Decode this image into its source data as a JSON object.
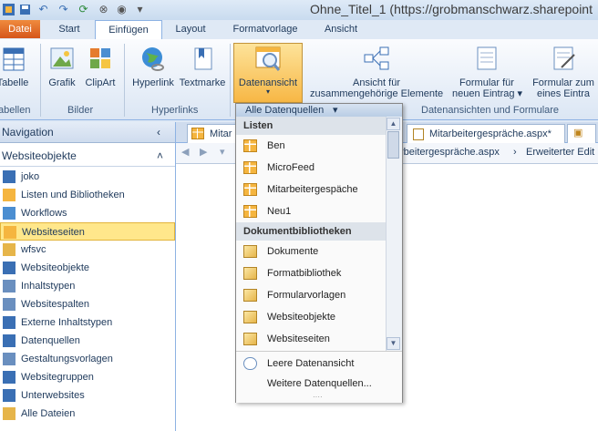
{
  "window": {
    "title": "Ohne_Titel_1 (https://grobmanschwarz.sharepoint"
  },
  "tabs": [
    "Datei",
    "Start",
    "Einfügen",
    "Layout",
    "Formatvorlage",
    "Ansicht"
  ],
  "ribbon": {
    "buttons": {
      "tabelle": "Tabelle",
      "grafik": "Grafik",
      "clipart": "ClipArt",
      "hyperlink": "Hyperlink",
      "textmarke": "Textmarke",
      "datenansicht": "Datenansicht",
      "ansicht_line1": "Ansicht für",
      "ansicht_line2": "zusammengehörige Elemente",
      "formular_neu_line1": "Formular für",
      "formular_neu_line2": "neuen Eintrag",
      "formular_zum_line1": "Formular zum",
      "formular_zum_line2": "eines Eintra"
    },
    "groups": {
      "tabellen": "abellen",
      "bilder": "Bilder",
      "hyperlinks": "Hyperlinks",
      "datenansichten": "Datenansichten und Formulare"
    }
  },
  "nav": {
    "header": "Navigation",
    "section": "Websiteobjekte",
    "items": [
      {
        "label": "joko",
        "icon": "site-icon"
      },
      {
        "label": "Listen und Bibliotheken",
        "icon": "list-icon"
      },
      {
        "label": "Workflows",
        "icon": "workflow-icon"
      },
      {
        "label": "Websiteseiten",
        "icon": "page-icon"
      },
      {
        "label": "wfsvc",
        "icon": "folder-icon"
      },
      {
        "label": "Websiteobjekte",
        "icon": "site-objects-icon"
      },
      {
        "label": "Inhaltstypen",
        "icon": "content-types-icon"
      },
      {
        "label": "Websitespalten",
        "icon": "columns-icon"
      },
      {
        "label": "Externe Inhaltstypen",
        "icon": "external-content-icon"
      },
      {
        "label": "Datenquellen",
        "icon": "data-sources-icon"
      },
      {
        "label": "Gestaltungsvorlagen",
        "icon": "master-page-icon"
      },
      {
        "label": "Websitegruppen",
        "icon": "groups-icon"
      },
      {
        "label": "Unterwebsites",
        "icon": "subsites-icon"
      },
      {
        "label": "Alle Dateien",
        "icon": "all-files-icon"
      }
    ],
    "selected": "Websiteseiten"
  },
  "doc": {
    "tab1": "Mitar",
    "tab2": "Mitarbeitergespräche.aspx*",
    "breadcrumb1": "rbeitergespräche.aspx",
    "breadcrumb2": "Erweiterter Edit"
  },
  "dropdown": {
    "header": "Alle Datenquellen",
    "sections": [
      {
        "title": "Listen",
        "items": [
          "Ben",
          "MicroFeed",
          "Mitarbeitergespäche",
          "Neu1"
        ]
      },
      {
        "title": "Dokumentbibliotheken",
        "items": [
          "Dokumente",
          "Formatbibliothek",
          "Formularvorlagen",
          "Websiteobjekte",
          "Websiteseiten"
        ]
      }
    ],
    "footer": [
      "Leere Datenansicht",
      "Weitere Datenquellen..."
    ]
  },
  "colors": {
    "accent": "#f5b53f",
    "selection": "#ffe78b",
    "file_tab": "#d5561a"
  }
}
